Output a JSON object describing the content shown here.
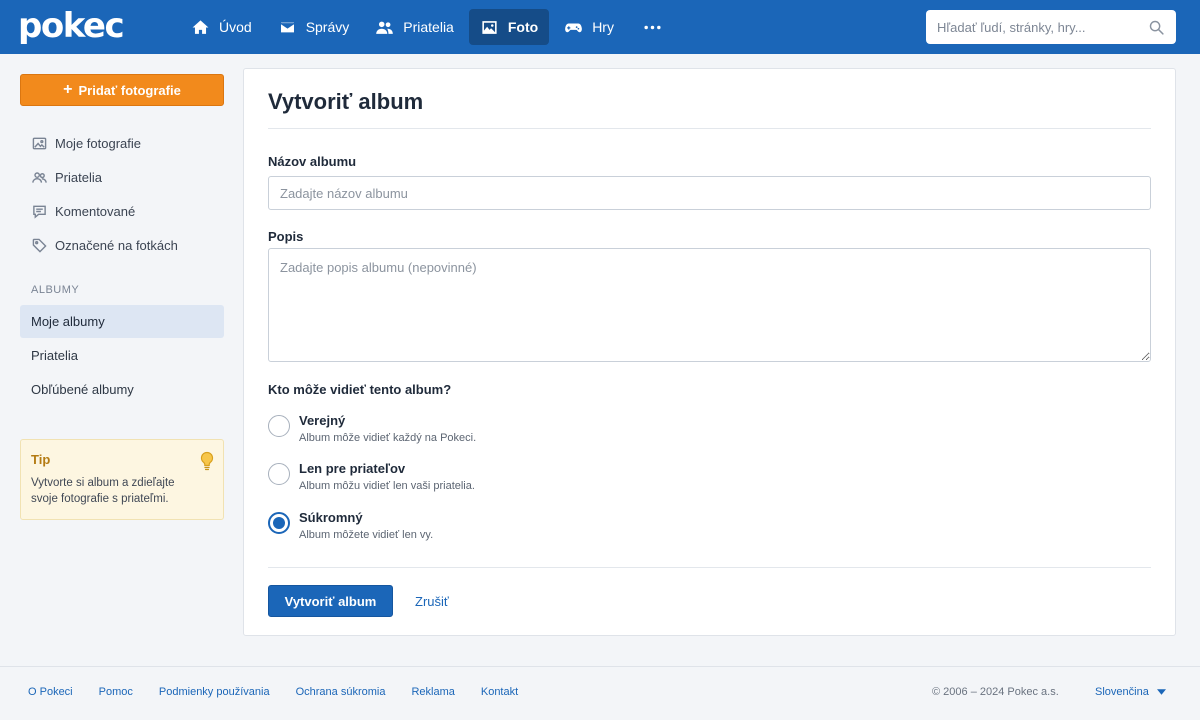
{
  "header": {
    "logo": "pokec",
    "nav": [
      {
        "label": "Úvod",
        "icon": "home-icon"
      },
      {
        "label": "Správy",
        "icon": "mail-icon"
      },
      {
        "label": "Priatelia",
        "icon": "friends-icon"
      },
      {
        "label": "Foto",
        "icon": "photo-icon",
        "active": true
      },
      {
        "label": "Hry",
        "icon": "gamepad-icon"
      }
    ],
    "more_icon": "more-dots-icon",
    "search": {
      "placeholder": "Hľadať ľudí, stránky, hry...",
      "value": "",
      "icon": "search-icon"
    }
  },
  "sidebar": {
    "add_button": {
      "plus": "+",
      "label": "Pridať fotografie"
    },
    "menu": [
      {
        "label": "Moje fotografie",
        "icon": "image-icon"
      },
      {
        "label": "Priatelia",
        "icon": "friends-icon"
      },
      {
        "label": "Komentované",
        "icon": "comment-icon"
      },
      {
        "label": "Označené na fotkách",
        "icon": "tag-icon"
      }
    ],
    "albums_heading": "ALBUMY",
    "albums": [
      {
        "label": "Moje albumy",
        "active": true
      },
      {
        "label": "Priatelia"
      },
      {
        "label": "Obľúbené albumy"
      }
    ],
    "tip": {
      "title": "Tip",
      "text": "Vytvorte si album a zdieľajte svoje fotografie s priateľmi.",
      "icon": "lightbulb-icon"
    }
  },
  "main": {
    "title": "Vytvoriť album",
    "name_label": "Názov albumu",
    "name_placeholder": "Zadajte názov albumu",
    "name_value": "",
    "description_label": "Popis",
    "description_placeholder": "Zadajte popis albumu (nepovinné)",
    "visibility_label": "Kto môže vidieť tento album?",
    "visibility_options": [
      {
        "label": "Verejný",
        "desc": "Album môže vidieť každý na Pokeci."
      },
      {
        "label": "Len pre priateľov",
        "desc": "Album môžu vidieť len vaši priatelia."
      },
      {
        "label": "Súkromný",
        "desc": "Album môžete vidieť len vy.",
        "selected": true
      }
    ],
    "submit_label": "Vytvoriť album",
    "cancel_label": "Zrušiť"
  },
  "footer": {
    "links": [
      "O Pokeci",
      "Pomoc",
      "Podmienky používania",
      "Ochrana súkromia",
      "Reklama",
      "Kontakt"
    ],
    "copyright": "© 2006 – 2024 Pokec a.s.",
    "language": "Slovenčina"
  },
  "colors": {
    "header_bg": "#1b66b8",
    "accent_orange": "#f28a1c",
    "primary_blue": "#1b66b8",
    "tip_bg": "#fdf6e1"
  }
}
